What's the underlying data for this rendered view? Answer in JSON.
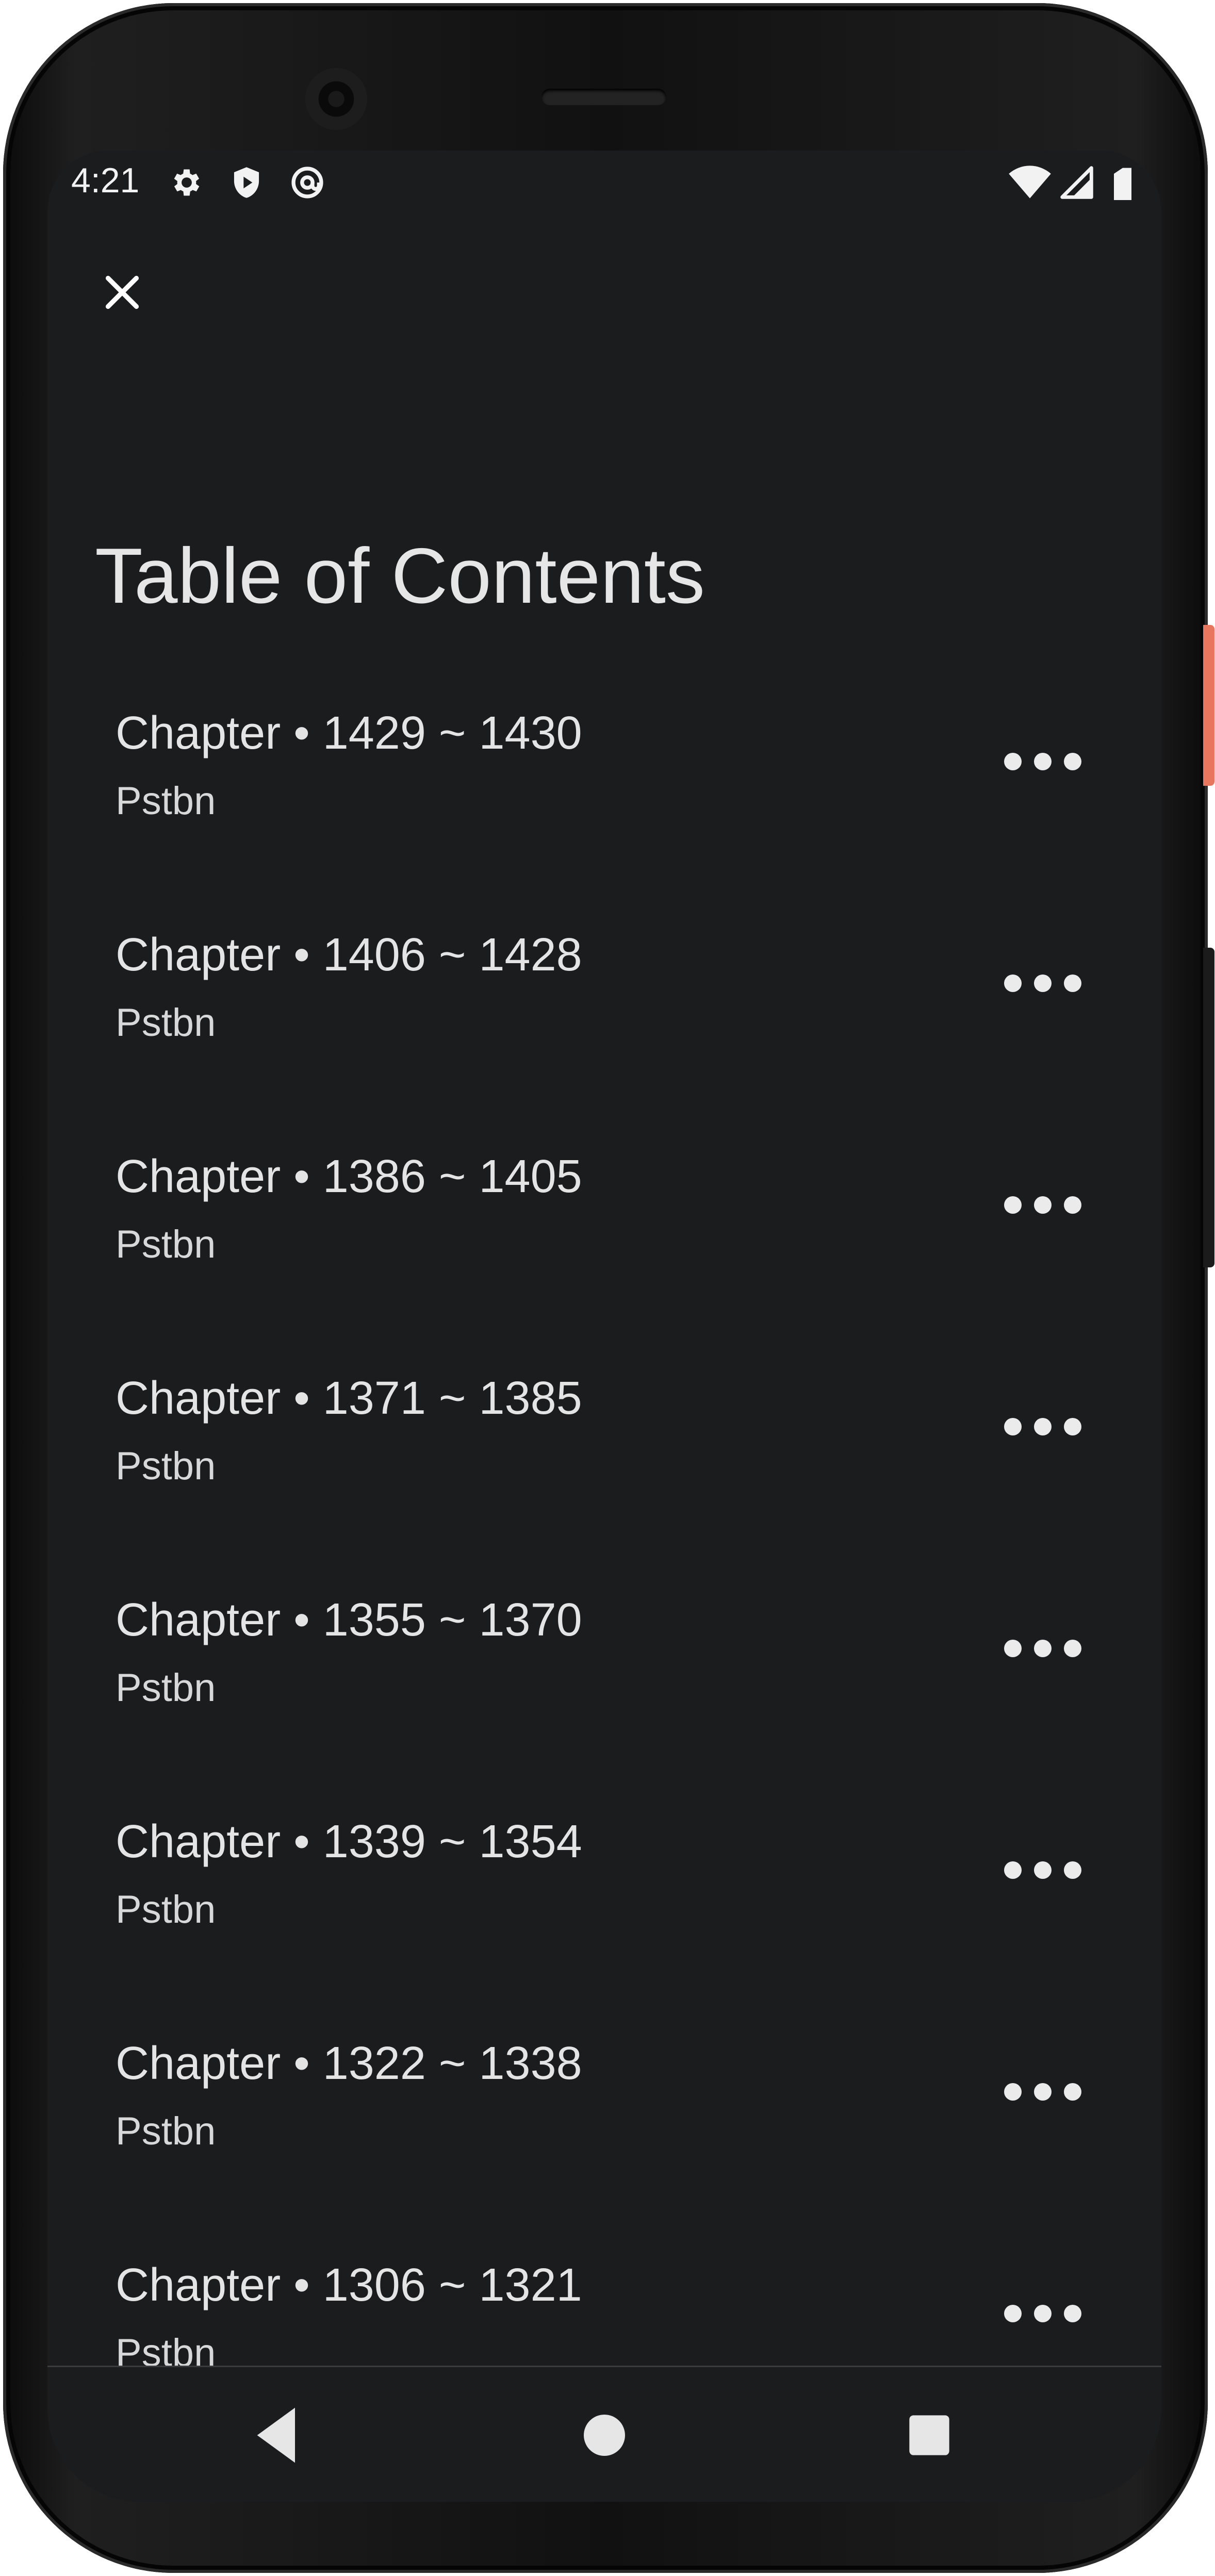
{
  "status_bar": {
    "time": "4:21",
    "left_icons": [
      "gear-icon",
      "shield-play-icon",
      "at-sign-icon"
    ],
    "right_icons": [
      "wifi-icon",
      "signal-icon",
      "battery-icon"
    ]
  },
  "header": {
    "close_icon": "close-icon",
    "title": "Table of Contents"
  },
  "toc": {
    "items": [
      {
        "title": "Chapter • 1429 ~ 1430",
        "subtitle": "Pstbn"
      },
      {
        "title": "Chapter • 1406 ~ 1428",
        "subtitle": "Pstbn"
      },
      {
        "title": "Chapter • 1386 ~ 1405",
        "subtitle": "Pstbn"
      },
      {
        "title": "Chapter • 1371 ~ 1385",
        "subtitle": "Pstbn"
      },
      {
        "title": "Chapter • 1355 ~ 1370",
        "subtitle": "Pstbn"
      },
      {
        "title": "Chapter • 1339 ~ 1354",
        "subtitle": "Pstbn"
      },
      {
        "title": "Chapter • 1322 ~ 1338",
        "subtitle": "Pstbn"
      },
      {
        "title": "Chapter • 1306 ~ 1321",
        "subtitle": "Pstbn"
      }
    ],
    "more_icon": "more-horizontal-icon"
  },
  "nav_bar": {
    "icons": [
      "back-icon",
      "home-icon",
      "recents-icon"
    ]
  },
  "colors": {
    "background": "#1b1c1e",
    "text_primary": "#e4e4e4",
    "icon": "#ffffff",
    "accent_button": "#e8765e"
  }
}
